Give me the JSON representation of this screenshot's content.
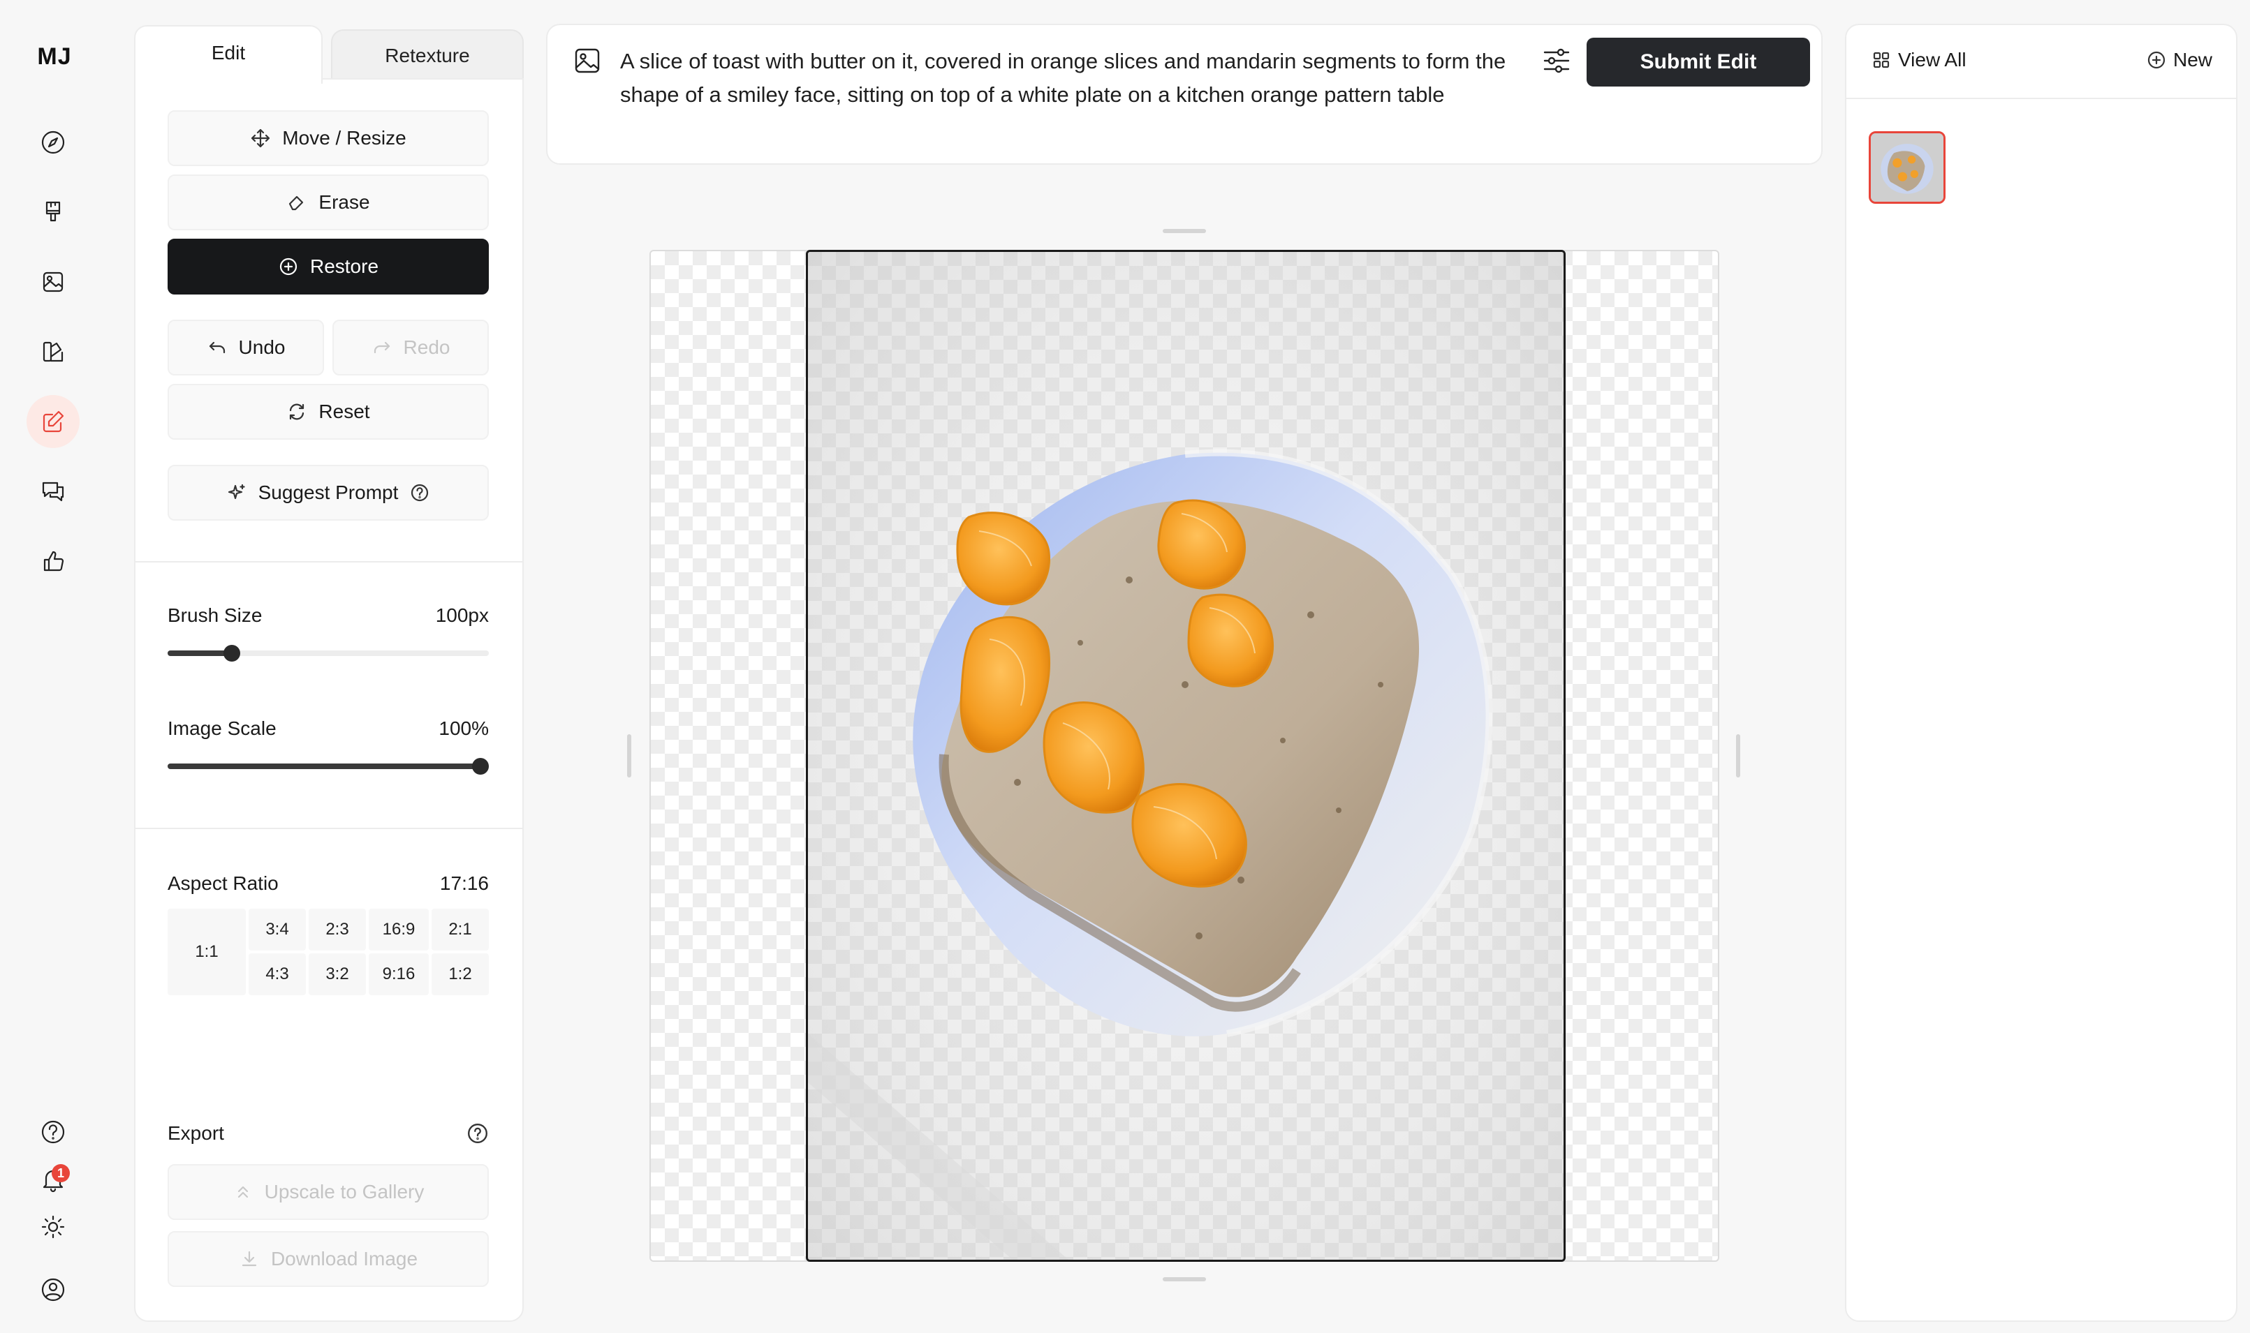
{
  "app": {
    "logo": "MJ"
  },
  "nav": {
    "items": [
      "explore",
      "create",
      "gallery",
      "organize",
      "edit",
      "chat",
      "rate"
    ],
    "active": "edit",
    "notification_count": "1"
  },
  "tabs": {
    "edit": "Edit",
    "retexture": "Retexture"
  },
  "tools": {
    "move_resize": "Move / Resize",
    "erase": "Erase",
    "restore": "Restore",
    "undo": "Undo",
    "redo": "Redo",
    "reset": "Reset",
    "suggest_prompt": "Suggest Prompt"
  },
  "brush": {
    "label": "Brush Size",
    "value_text": "100px",
    "fraction": 0.2
  },
  "scale": {
    "label": "Image Scale",
    "value_text": "100%",
    "fraction": 1.0
  },
  "aspect": {
    "label": "Aspect Ratio",
    "value": "17:16",
    "square": "1:1",
    "row1": [
      "3:4",
      "2:3",
      "16:9",
      "2:1"
    ],
    "row2": [
      "4:3",
      "3:2",
      "9:16",
      "1:2"
    ]
  },
  "export": {
    "label": "Export",
    "upscale": "Upscale to Gallery",
    "download": "Download Image"
  },
  "prompt": {
    "text": "A slice of toast with butter on it, covered in orange slices and mandarin segments to form the shape of a smiley face, sitting on top of a white plate on a kitchen orange pattern table",
    "submit": "Submit Edit"
  },
  "right": {
    "view_all": "View All",
    "new": "New"
  },
  "colors": {
    "accent": "#e8453a",
    "dark_button": "#17181a"
  }
}
